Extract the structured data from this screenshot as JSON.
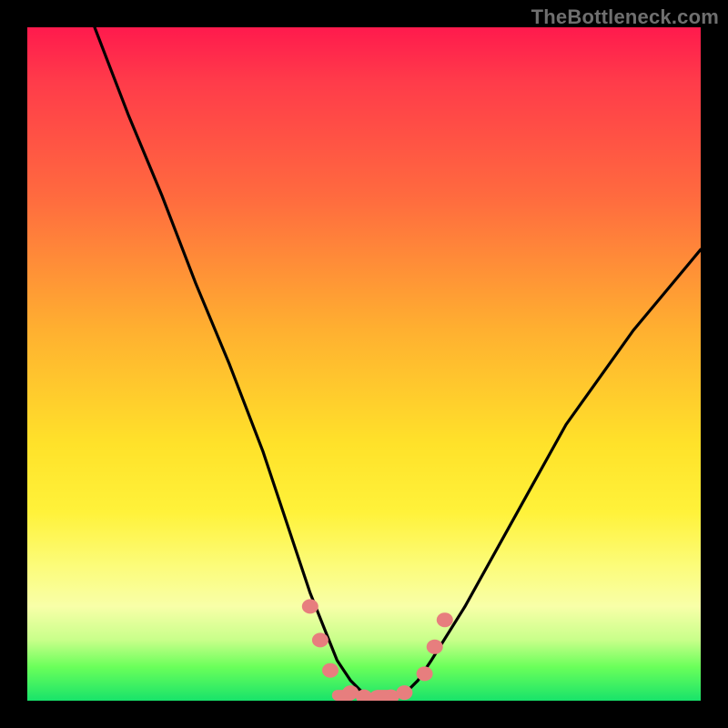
{
  "watermark": "TheBottleneck.com",
  "chart_data": {
    "type": "line",
    "title": "",
    "xlabel": "",
    "ylabel": "",
    "xlim": [
      0,
      100
    ],
    "ylim": [
      0,
      100
    ],
    "series": [
      {
        "name": "curve",
        "x": [
          10,
          15,
          20,
          25,
          30,
          35,
          38,
          40,
          42,
          44,
          46,
          48,
          50,
          52,
          54,
          56,
          58,
          60,
          65,
          70,
          75,
          80,
          85,
          90,
          95,
          100
        ],
        "y": [
          100,
          87,
          75,
          62,
          50,
          37,
          28,
          22,
          16,
          11,
          6,
          3,
          1,
          0.5,
          0.5,
          1,
          3,
          6,
          14,
          23,
          32,
          41,
          48,
          55,
          61,
          67
        ]
      }
    ],
    "markers": [
      {
        "x": 42,
        "y": 14
      },
      {
        "x": 43.5,
        "y": 9
      },
      {
        "x": 45,
        "y": 4.5
      },
      {
        "x": 48,
        "y": 1.2
      },
      {
        "x": 50,
        "y": 0.6
      },
      {
        "x": 52,
        "y": 0.5
      },
      {
        "x": 54,
        "y": 0.6
      },
      {
        "x": 56,
        "y": 1.2
      },
      {
        "x": 59,
        "y": 4
      },
      {
        "x": 60.5,
        "y": 8
      },
      {
        "x": 62,
        "y": 12
      }
    ],
    "colors": {
      "curve": "#000000",
      "markers_fill": "#e77e7e",
      "markers_stroke": "#a43f3f"
    }
  }
}
